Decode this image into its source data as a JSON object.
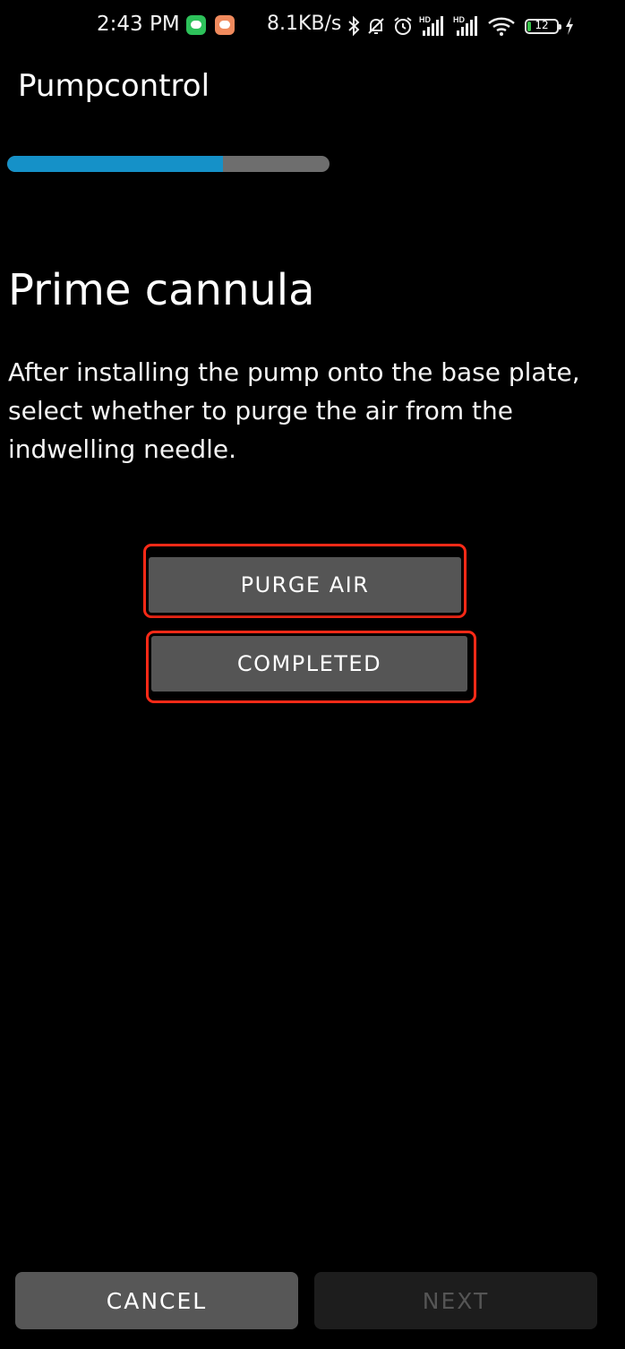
{
  "status_bar": {
    "time": "2:43 PM",
    "network_speed": "8.1KB/s",
    "battery_level": "12",
    "icons": [
      "wechat-icon",
      "app-notification-icon",
      "bluetooth-icon",
      "mute-icon",
      "alarm-icon",
      "signal-hd-icon",
      "signal-hd-icon",
      "wifi-icon",
      "battery-icon",
      "charging-icon"
    ]
  },
  "header": {
    "title": "Pumpcontrol"
  },
  "progress": {
    "value_percent": 67,
    "fill_color": "#1591c8",
    "track_color": "#6e6e6e"
  },
  "main": {
    "heading": "Prime cannula",
    "description": "After installing the pump onto the base plate, select whether to purge the air from the indwelling needle.",
    "purge_button_label": "PURGE AIR",
    "completed_button_label": "COMPLETED",
    "highlight_color": "#ff2a17"
  },
  "footer": {
    "cancel_label": "CANCEL",
    "next_label": "NEXT",
    "next_enabled": false
  }
}
